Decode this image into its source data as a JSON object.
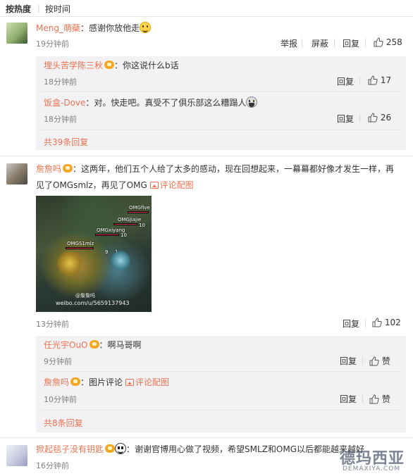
{
  "sort": {
    "hot": "按热度",
    "time": "按时间"
  },
  "c1": {
    "user": "Meng_萌蘗",
    "text": "感谢你放他走",
    "time": "19分钟前",
    "report": "举报",
    "block": "屏蔽",
    "reply": "回复",
    "likes": "258",
    "replies": [
      {
        "user": "埋头苦学陈三秋",
        "text": "你这说什么b话",
        "time": "18分钟前",
        "reply": "回复",
        "likes": "17"
      },
      {
        "user": "饭盒-Dove",
        "text": "对。快走吧。真受不了俱乐部这么糟蹋人",
        "time": "18分钟前",
        "reply": "回复",
        "likes": "26"
      }
    ],
    "more": "共39条回复"
  },
  "c2": {
    "user": "詹詹吗",
    "text1": "这两年，他们五个人给了太多的感动，现在回想起来，一幕幕都好像才发生一样，再",
    "text2": "见了OMGsmlz，再见了OMG",
    "pic_link": "评论配图",
    "image": {
      "labels": [
        "OMGfive",
        "OMGjiajie",
        "OMGxiyang",
        "OMGS1mlz",
        "@詹詹吗",
        "weibo.com/u/5659137943"
      ],
      "numbers": [
        "10",
        "10",
        "9",
        "1"
      ]
    },
    "time": "13分钟前",
    "reply": "回复",
    "likes": "102",
    "replies": [
      {
        "user": "任光宇OuO",
        "text": "啊马哥啊",
        "time": "9分钟前",
        "reply": "回复",
        "likes": "赞"
      },
      {
        "user": "詹詹吗",
        "text": "图片评论",
        "pic_link": "评论配图",
        "time": "10分钟前",
        "reply": "回复",
        "likes": "赞"
      }
    ],
    "more": "共8条回复"
  },
  "c3": {
    "user": "掀起毯子没有钥匙",
    "text": "谢谢官博用心做了视频，希望SMLZ和OMG以后都能越来越好",
    "time": "16分钟前"
  },
  "watermark": {
    "big": "德玛西亚",
    "small": "DEMAXIYA.COM"
  },
  "colors": {
    "username": "#eb7350",
    "replybg": "#f2f2f5",
    "timestamp": "#808080"
  }
}
